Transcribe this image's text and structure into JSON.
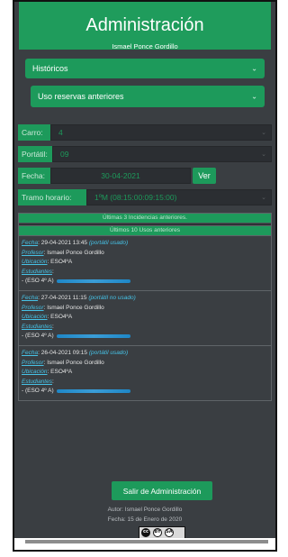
{
  "header": {
    "title": "Administración",
    "subtitle": "Ismael Ponce Gordillo"
  },
  "dropdowns": {
    "historicos": "Históricos",
    "uso_reservas": "Uso reservas anteriores"
  },
  "form": {
    "carro_label": "Carro:",
    "carro_value": "4",
    "portatil_label": "Portátil:",
    "portatil_value": "09",
    "fecha_label": "Fecha:",
    "fecha_value": "30-04-2021",
    "ver_label": "Ver",
    "tramo_label": "Tramo horario:",
    "tramo_value": "1ºM (08:15:00:09:15:00)"
  },
  "incidencias": {
    "title": "Últimas 3 Incidencias anteriores.",
    "empty": "No hay Incidencias."
  },
  "usos": {
    "title": "Últimos 10 Usos anteriores",
    "key_fecha": "Fecha",
    "key_profesor": "Profesor",
    "key_ubicacion": "Ubicación",
    "key_estudiantes": "Estudiantes",
    "items": [
      {
        "fecha": "29-04-2021 13:45",
        "estado": "(portátil usado)",
        "profesor": "Ismael Ponce Gordillo",
        "ubicacion": "ESO4ºA",
        "estudiante_grupo": "- (ESO 4º A)"
      },
      {
        "fecha": "27-04-2021 11:15",
        "estado": "(portátil no usado)",
        "profesor": "Ismael Ponce Gordillo",
        "ubicacion": "ESO4ºA",
        "estudiante_grupo": "- (ESO 4º A)"
      },
      {
        "fecha": "26-04-2021 09:15",
        "estado": "(portátil usado)",
        "profesor": "Ismael Ponce Gordillo",
        "ubicacion": "ESO4ºA",
        "estudiante_grupo": "- (ESO 4º A)"
      }
    ]
  },
  "footer": {
    "exit_label": "Salir de Administración",
    "autor": "Autor: Ismael Ponce Gordillo",
    "fecha": "Fecha: 15 de Enero de 2020",
    "license": {
      "cc": "cc",
      "by": "BY",
      "sa": "SA"
    }
  },
  "icons": {
    "chevron": "chevron-down-icon",
    "license": "creative-commons-icon"
  },
  "colors": {
    "accent": "#1d9a5b",
    "background": "#3a3e42",
    "link": "#46c2e6"
  }
}
